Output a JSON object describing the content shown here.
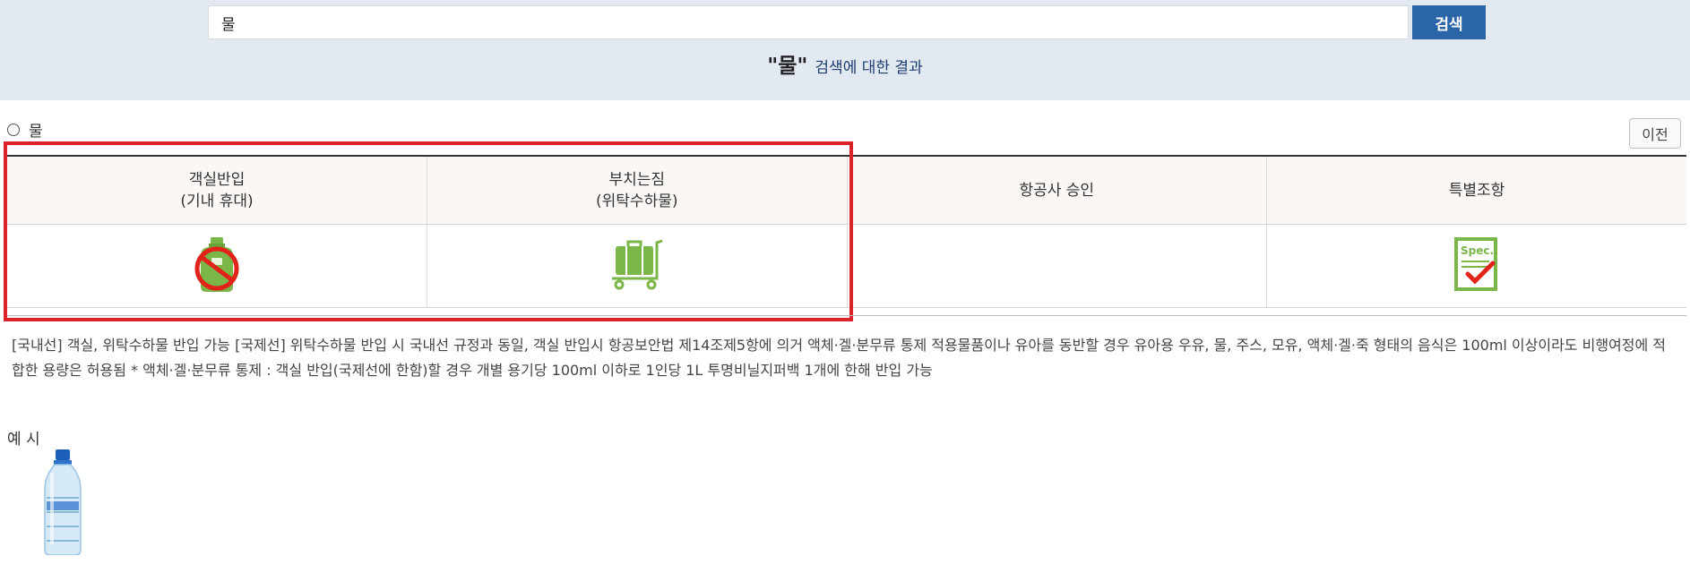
{
  "search": {
    "value": "물",
    "button_label": "검색"
  },
  "result_caption": {
    "keyword": "\"물\"",
    "suffix": "검색에 대한 결과"
  },
  "item": {
    "name": "물",
    "prev_button": "이전"
  },
  "table": {
    "headers": [
      {
        "line1": "객실반입",
        "line2": "(기내 휴대)"
      },
      {
        "line1": "부치는짐",
        "line2": "(위탁수하물)"
      },
      {
        "line1": "항공사 승인",
        "line2": ""
      },
      {
        "line1": "특별조항",
        "line2": ""
      }
    ],
    "cells": [
      {
        "icon": "no-carry-on-bag-icon",
        "label": ""
      },
      {
        "icon": "luggage-cart-icon",
        "label": ""
      },
      {
        "icon": "",
        "label": ""
      },
      {
        "icon": "spec-checklist-icon",
        "label": "Spec."
      }
    ]
  },
  "description": "[국내선] 객실, 위탁수하물 반입 가능 [국제선] 위탁수하물 반입 시 국내선 규정과 동일, 객실 반입시 항공보안법 제14조제5항에 의거 액체·겔·분무류 통제 적용물품이나 유아를 동반할 경우 유아용 우유, 물, 주스, 모유, 액체·겔·죽 형태의 음식은 100ml 이상이라도 비행여정에 적합한 용량은 허용됨 * 액체·겔·분무류 통제 : 객실 반입(국제선에 한함)할 경우 개별 용기당 100ml 이하로 1인당 1L 투명비닐지퍼백 1개에 한해 반입 가능",
  "example": {
    "label": "예 시",
    "image": "water-bottle-image"
  },
  "colors": {
    "band": "#e3e9f1",
    "accent": "#2a65a8",
    "highlight": "#d9222a",
    "icon_green": "#7ab648",
    "prohibit_red": "#e2231a"
  }
}
